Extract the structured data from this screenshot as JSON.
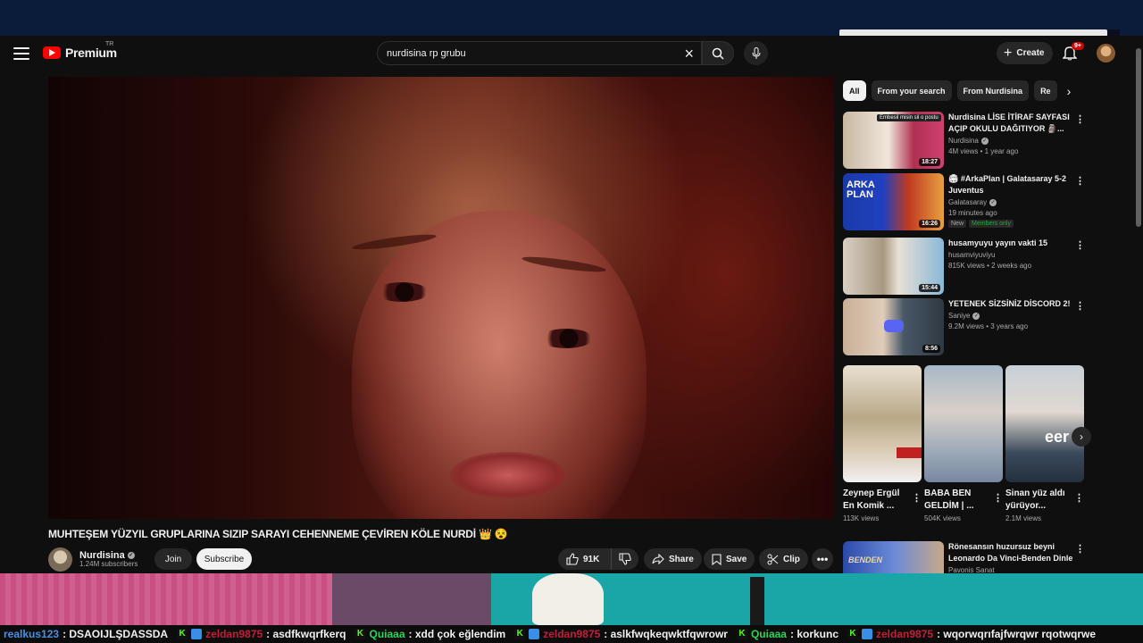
{
  "header": {
    "brand": "Premium",
    "region": "TR",
    "search_value": "nurdisina rp grubu",
    "create_label": "Create",
    "notif_count": "9+"
  },
  "video": {
    "title": "MUHTEŞEM YÜZYIL GRUPLARINA SIZIP SARAYI CEHENNEME ÇEVİREN KÖLE NURDİ 👑 😵",
    "channel": "Nurdisina",
    "subscribers": "1.24M subscribers",
    "join_label": "Join",
    "subscribe_label": "Subscribe",
    "likes": "91K",
    "share_label": "Share",
    "save_label": "Save",
    "clip_label": "Clip"
  },
  "chips": [
    {
      "label": "All"
    },
    {
      "label": "From your search"
    },
    {
      "label": "From Nurdisina"
    },
    {
      "label": "Re"
    }
  ],
  "recommendations": [
    {
      "title": "Nurdisina LİSE İTİRAF SAYFASI AÇIP OKULU DAĞITIYOR 🗿...",
      "channel": "Nurdisina",
      "meta": "4M views • 1 year ago",
      "duration": "18:27",
      "thumb_text": "Embesil misin sil o postu"
    },
    {
      "title": "🏟 #ArkaPlan | Galatasaray 5-2 Juventus",
      "channel": "Galatasaray",
      "meta": "19 minutes ago",
      "duration": "16:26",
      "badge_new": "New",
      "badge_members": "Members only",
      "thumb_text": "ARKA PLAN"
    },
    {
      "title": "husamyuyu yayın vakti 15",
      "channel": "husamviyuviyu",
      "meta": "815K views • 2 weeks ago",
      "duration": "15:44"
    },
    {
      "title": "YETENEK SİZSİNİZ DİSCORD 2!",
      "channel": "Saniye",
      "meta": "9.2M views • 3 years ago",
      "duration": "8:56"
    }
  ],
  "shorts": [
    {
      "title": "Zeynep Ergül En Komik ...",
      "views": "113K views"
    },
    {
      "title": "BABA BEN GELDİM | ...",
      "views": "504K views"
    },
    {
      "title": "Sinan yüz aldı yürüyor...",
      "views": "2.1M views",
      "thumb_text": "eer"
    }
  ],
  "partial_rec": {
    "title": "Rönesansın huzursuz beyni Leonardo Da Vinci-Benden Dinle",
    "channel": "Pavonis Sanat",
    "thumb_text": "BENDEN"
  },
  "chat": [
    {
      "user": "realkus123",
      "text": ": DSAOIJLŞDASSDA"
    },
    {
      "user": "zeldan9875",
      "text": ": asdfkwqrfkerq"
    },
    {
      "user": "Quiaaa",
      "text": ": xdd çok eğlendim"
    },
    {
      "user": "zeldan9875",
      "text": ": aslkfwqkeqwktfqwrowr"
    },
    {
      "user": "Quiaaa",
      "text": ": korkunc"
    },
    {
      "user": "zeldan9875",
      "text": ": wqorwqrıfajfwrqwr rqotwqrwe"
    }
  ],
  "colors": {
    "accent_red": "#ff0000",
    "members_green": "#2ba640",
    "chat_blue": "#4a90e2",
    "chat_red": "#c41e3a",
    "chat_green": "#2dd35a"
  }
}
